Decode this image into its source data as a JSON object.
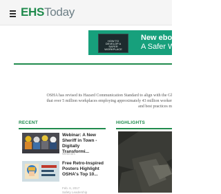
{
  "header": {
    "logo_bold": "EHS",
    "logo_light": "Today"
  },
  "banner": {
    "book_text": "How to develop a safer workplace",
    "title": "New ebo",
    "subtitle": "A Safer W"
  },
  "notice_lines": [
    "OSHA has revised its Hazard Communication Standard to align with the Gl",
    "that over 5 million workplaces employing approximately 43 million worker",
    "and best practices m"
  ],
  "sections": {
    "recent": "RECENT",
    "highlights": "HIGHLIGHTS"
  },
  "articles": [
    {
      "title": "Webinar: A New Sheriff in Town - Digitally Transformi...",
      "meta": "Webinars"
    },
    {
      "title": "Free Retro-Inspired Posters Highlight OSHA's Top 10...",
      "meta": "Feb. 6, 2017",
      "category": "Safety Leadership"
    }
  ],
  "colors": {
    "brand_green": "#1f8a4c",
    "banner_teal": "#17a07c",
    "logo_grey": "#6d7f86"
  },
  "icons": {
    "menu": "hamburger-icon"
  }
}
